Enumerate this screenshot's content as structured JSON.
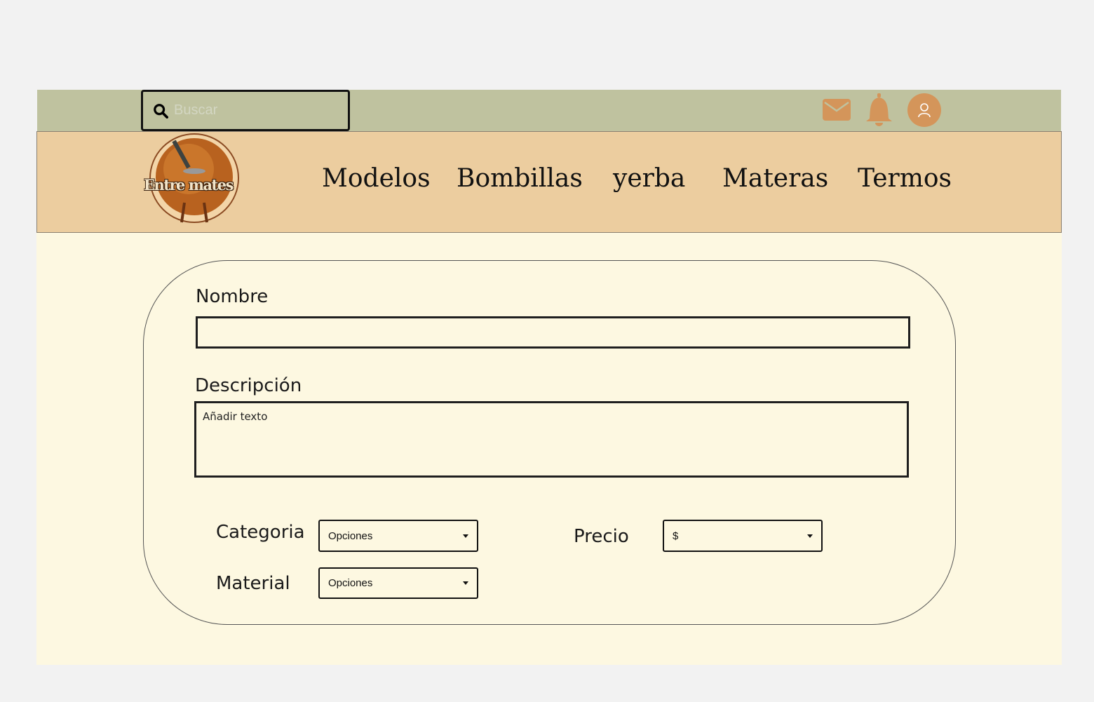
{
  "header": {
    "search_placeholder": "Buscar",
    "logo_text": "Entre mates",
    "accent": "#d4955a"
  },
  "nav": {
    "items": [
      "Modelos",
      "Bombillas",
      "yerba",
      "Materas",
      "Termos"
    ]
  },
  "form": {
    "nombre_label": "Nombre",
    "nombre_value": "",
    "descripcion_label": "Descripción",
    "descripcion_placeholder": "Añadir texto",
    "categoria_label": "Categoria",
    "categoria_value": "Opciones",
    "material_label": "Material",
    "material_value": "Opciones",
    "precio_label": "Precio",
    "precio_value": "$"
  }
}
